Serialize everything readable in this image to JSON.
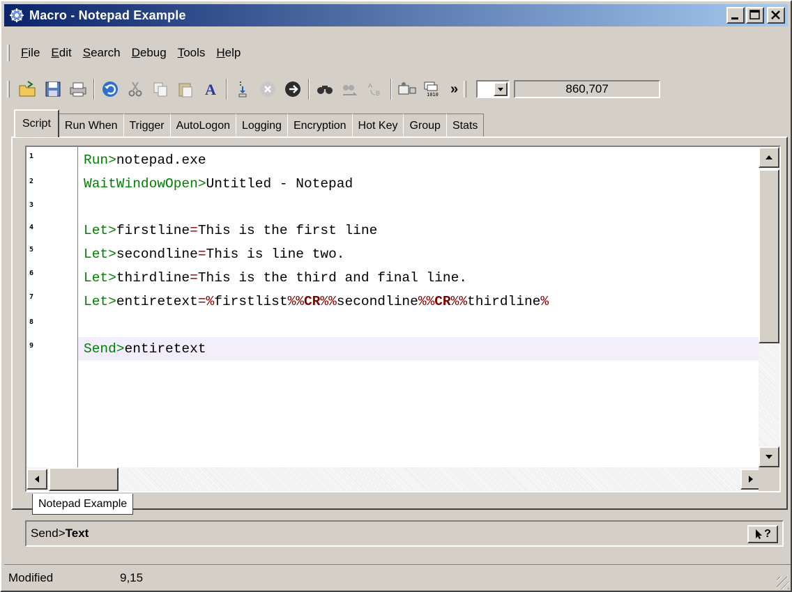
{
  "window": {
    "title": "Macro - Notepad Example"
  },
  "menu": {
    "items": [
      {
        "label": "File"
      },
      {
        "label": "Edit"
      },
      {
        "label": "Search"
      },
      {
        "label": "Debug"
      },
      {
        "label": "Tools"
      },
      {
        "label": "Help"
      }
    ]
  },
  "toolbar": {
    "icons": [
      "open-folder-icon",
      "save-icon",
      "print-icon",
      "undo-icon",
      "cut-icon",
      "copy-icon",
      "paste-icon",
      "font-icon",
      "step-icon",
      "stop-icon",
      "run-icon",
      "find-icon",
      "find-next-icon",
      "replace-icon",
      "record-icon",
      "binary-icon"
    ],
    "overflow": "»",
    "counter": "860,707"
  },
  "tabs": [
    "Script",
    "Run When",
    "Trigger",
    "AutoLogon",
    "Logging",
    "Encryption",
    "Hot Key",
    "Group",
    "Stats"
  ],
  "editor": {
    "line_numbers": [
      "1",
      "2",
      "3",
      "4",
      "5",
      "6",
      "7",
      "8",
      "9"
    ],
    "lines": [
      {
        "kw": "Run>",
        "rest": "notepad.exe"
      },
      {
        "kw": "WaitWindowOpen>",
        "rest": "Untitled - Notepad"
      },
      {
        "kw": "",
        "rest": ""
      },
      {
        "kw": "Let>",
        "var": "firstline",
        "op": "=",
        "rest": "This is the first line"
      },
      {
        "kw": "Let>",
        "var": "secondline",
        "op": "=",
        "rest": "This is line two."
      },
      {
        "kw": "Let>",
        "var": "thirdline",
        "op": "=",
        "rest": "This is the third and final line."
      },
      {
        "kw": "Let>",
        "var": "entiretext",
        "op": "=",
        "rest": "%firstlist%%CR%%secondline%%CR%%thirdline%"
      },
      {
        "kw": "",
        "rest": ""
      },
      {
        "kw": "Send>",
        "rest": "entiretext"
      }
    ]
  },
  "document_tab": "Notepad Example",
  "hint": {
    "prefix": "Send>",
    "bold": "Text",
    "help": "?"
  },
  "status": {
    "state": "Modified",
    "position": "9,15"
  },
  "colors": {
    "keyword": "#008000",
    "operator": "#800000",
    "highlight": "#f3eefb",
    "title_start": "#0a246a",
    "title_end": "#a6caf0"
  }
}
